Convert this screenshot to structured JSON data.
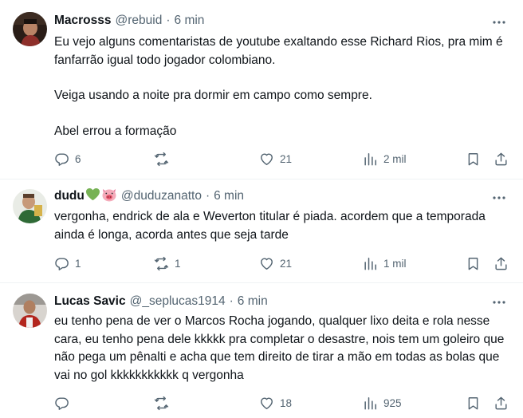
{
  "tweets": [
    {
      "name": "Macrosss",
      "handle": "@rebuid",
      "separator": "·",
      "time": "6 min",
      "paragraphs": [
        "Eu vejo alguns comentaristas de youtube exaltando esse Richard Rios, pra mim é fanfarrão igual todo jogador colombiano.",
        "Veiga usando a noite pra dormir em campo como sempre.",
        "Abel errou a formação"
      ],
      "replies": "6",
      "retweets": "",
      "likes": "21",
      "views": "2 mil"
    },
    {
      "name": "dudu",
      "name_emojis": [
        "green-heart-emoji",
        "pig-face-emoji"
      ],
      "handle": "@duduzanatto",
      "separator": "·",
      "time": "6 min",
      "paragraphs": [
        "vergonha, endrick de ala e Weverton titular é piada. acordem que a temporada ainda é longa, acorda antes que seja tarde"
      ],
      "replies": "1",
      "retweets": "1",
      "likes": "21",
      "views": "1 mil"
    },
    {
      "name": "Lucas Savic",
      "handle": "@_seplucas1914",
      "separator": "·",
      "time": "6 min",
      "paragraphs": [
        "eu tenho pena de ver o Marcos Rocha jogando, qualquer lixo deita e rola nesse cara, eu tenho pena dele kkkkk pra completar o desastre, nois tem um goleiro que não pega um pênalti e acha que tem direito de tirar a mão em todas as bolas que vai no gol kkkkkkkkkkk q vergonha"
      ],
      "replies": "",
      "retweets": "",
      "likes": "18",
      "views": "925"
    }
  ],
  "icons": {
    "reply": "reply-icon",
    "retweet": "retweet-icon",
    "like": "heart-icon",
    "views": "views-chart-icon",
    "bookmark": "bookmark-icon",
    "share": "share-icon",
    "more": "more-dots-icon"
  },
  "colors": {
    "text": "#0f1419",
    "secondary": "#536471",
    "divider": "#eff3f4"
  }
}
